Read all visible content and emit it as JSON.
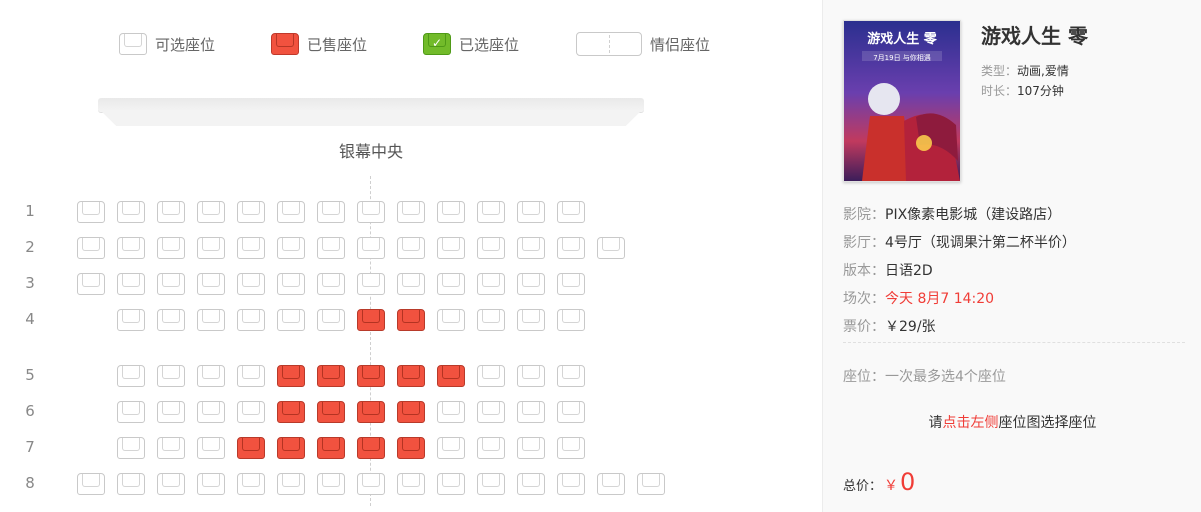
{
  "legend": {
    "available": "可选座位",
    "sold": "已售座位",
    "selected": "已选座位",
    "couple": "情侣座位",
    "check": "✓"
  },
  "screen": {
    "label": "银幕中央"
  },
  "rows": [
    {
      "label": "1",
      "seats": [
        "a",
        "a",
        "a",
        "a",
        "a",
        "a",
        "a",
        "a",
        "a",
        "a",
        "a",
        "a",
        "a"
      ]
    },
    {
      "label": "2",
      "seats": [
        "a",
        "a",
        "a",
        "a",
        "a",
        "a",
        "a",
        "a",
        "a",
        "a",
        "a",
        "a",
        "a",
        "a"
      ]
    },
    {
      "label": "3",
      "seats": [
        "a",
        "a",
        "a",
        "a",
        "a",
        "a",
        "a",
        "a",
        "a",
        "a",
        "a",
        "a",
        "a"
      ]
    },
    {
      "label": "4",
      "seats": [
        "-",
        "a",
        "a",
        "a",
        "a",
        "a",
        "a",
        "s",
        "s",
        "a",
        "a",
        "a",
        "a"
      ]
    },
    {
      "label": "5",
      "seats": [
        "-",
        "a",
        "a",
        "a",
        "a",
        "s",
        "s",
        "s",
        "s",
        "s",
        "a",
        "a",
        "a"
      ]
    },
    {
      "label": "6",
      "seats": [
        "-",
        "a",
        "a",
        "a",
        "a",
        "s",
        "s",
        "s",
        "s",
        "a",
        "a",
        "a",
        "a"
      ]
    },
    {
      "label": "7",
      "seats": [
        "-",
        "a",
        "a",
        "a",
        "s",
        "s",
        "s",
        "s",
        "s",
        "a",
        "a",
        "a",
        "a"
      ]
    },
    {
      "label": "8",
      "seats": [
        "a",
        "a",
        "a",
        "a",
        "a",
        "a",
        "a",
        "a",
        "a",
        "a",
        "a",
        "a",
        "a",
        "a",
        "a"
      ]
    }
  ],
  "movie": {
    "title": "游戏人生 零",
    "type_label": "类型：",
    "type_value": "动画,爱情",
    "duration_label": "时长：",
    "duration_value": "107分钟",
    "poster_title": "游戏人生 零",
    "poster_date": "7月19日 与你相遇"
  },
  "details": {
    "cinema_label": "影院：",
    "cinema_value": "PIX像素电影城（建设路店）",
    "hall_label": "影厅：",
    "hall_value": "4号厅（现调果汁第二杯半价）",
    "version_label": "版本：",
    "version_value": "日语2D",
    "showtime_label": "场次：",
    "showtime_value": "今天 8月7 14:20",
    "price_label": "票价：",
    "price_value": "￥29/张"
  },
  "seat_info": {
    "label": "座位：",
    "value": "一次最多选4个座位"
  },
  "hint": {
    "pre": "请",
    "highlight": "点击左侧",
    "post": "座位图选择座位"
  },
  "total": {
    "label": "总价：",
    "currency": "￥",
    "amount": "0"
  },
  "colors": {
    "sold": "#f1523f",
    "selected": "#72bb2a",
    "accent_red": "#f03d37"
  }
}
